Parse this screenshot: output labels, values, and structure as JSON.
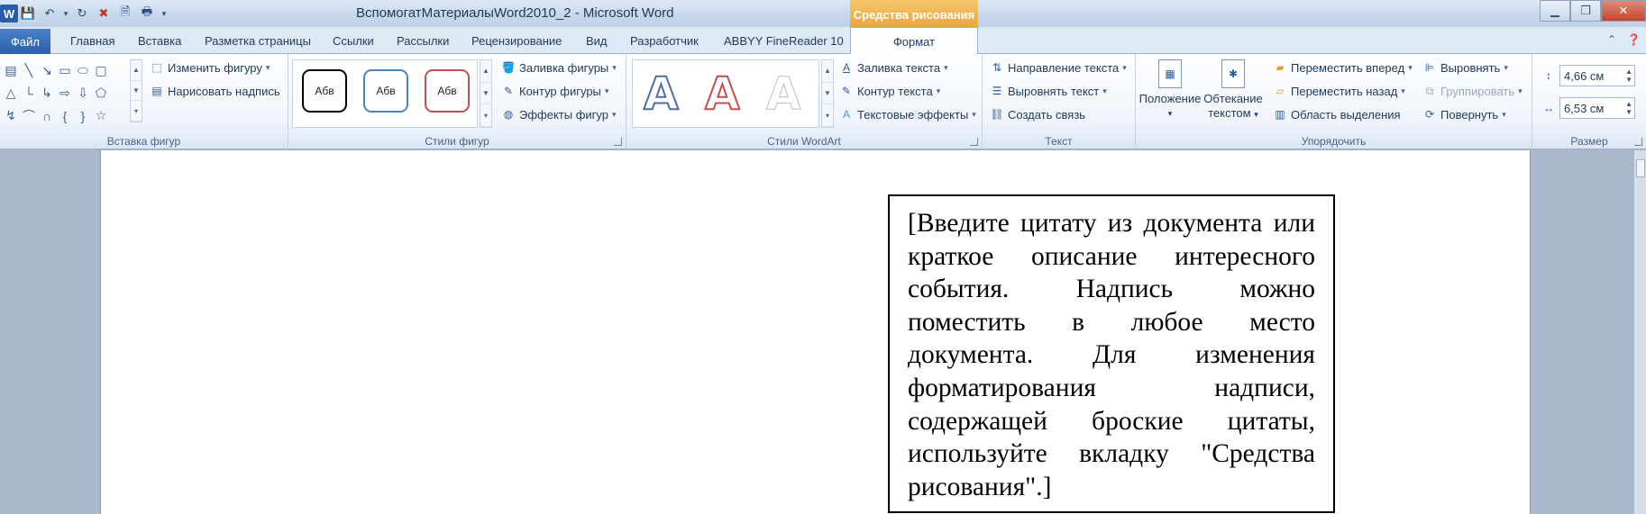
{
  "window": {
    "title": "ВспомогатМатериалыWord2010_2  -  Microsoft Word",
    "context_tab_header": "Средства рисования",
    "buttons": {
      "minimize": "▁",
      "restore": "❐",
      "close": "✕"
    }
  },
  "qat": {
    "logo": "W",
    "items": [
      "save-icon",
      "undo-icon",
      "redo-icon",
      "close-doc-icon",
      "preview-icon",
      "print-icon",
      "customize-icon"
    ],
    "dropdown": "▾"
  },
  "tabs": {
    "file": "Файл",
    "items": [
      "Главная",
      "Вставка",
      "Разметка страницы",
      "Ссылки",
      "Рассылки",
      "Рецензирование",
      "Вид",
      "Разработчик",
      "ABBYY FineReader 10"
    ],
    "active": "Формат"
  },
  "ribbon": {
    "insert_shapes": {
      "label": "Вставка фигур",
      "edit_shape": "Изменить фигуру",
      "draw_textbox": "Нарисовать надпись"
    },
    "shape_styles": {
      "label": "Стили фигур",
      "sample": "Абв",
      "fill": "Заливка фигуры",
      "outline": "Контур фигуры",
      "effects": "Эффекты фигур"
    },
    "wordart_styles": {
      "label": "Стили WordArt",
      "sample": "A",
      "text_fill": "Заливка текста",
      "text_outline": "Контур текста",
      "text_effects": "Текстовые эффекты"
    },
    "text": {
      "label": "Текст",
      "direction": "Направление текста",
      "align": "Выровнять текст",
      "create_link": "Создать связь"
    },
    "arrange": {
      "label": "Упорядочить",
      "position": "Положение",
      "wrap_line1": "Обтекание",
      "wrap_line2": "текстом",
      "bring_forward": "Переместить вперед",
      "send_backward": "Переместить назад",
      "selection_pane": "Область выделения",
      "align": "Выровнять",
      "group": "Группировать",
      "rotate": "Повернуть"
    },
    "size": {
      "label": "Размер",
      "height": "4,66 см",
      "width": "6,53 см"
    }
  },
  "document": {
    "quote_text": "[Введите цитату из документа или краткое описание интересного события. Надпись можно поместить в любое место документа. Для изменения форматирования надписи, содержащей броские цитаты, используйте вкладку \"Средства рисования\".]"
  },
  "colors": {
    "ribbon_bg": "#f1f5fb",
    "file_tab": "#2a5faa",
    "context_tab": "#e8a43a",
    "doc_bg": "#abb9ce",
    "style_black": "#000000",
    "style_blue": "#4f81bd",
    "style_red": "#c0504d"
  }
}
